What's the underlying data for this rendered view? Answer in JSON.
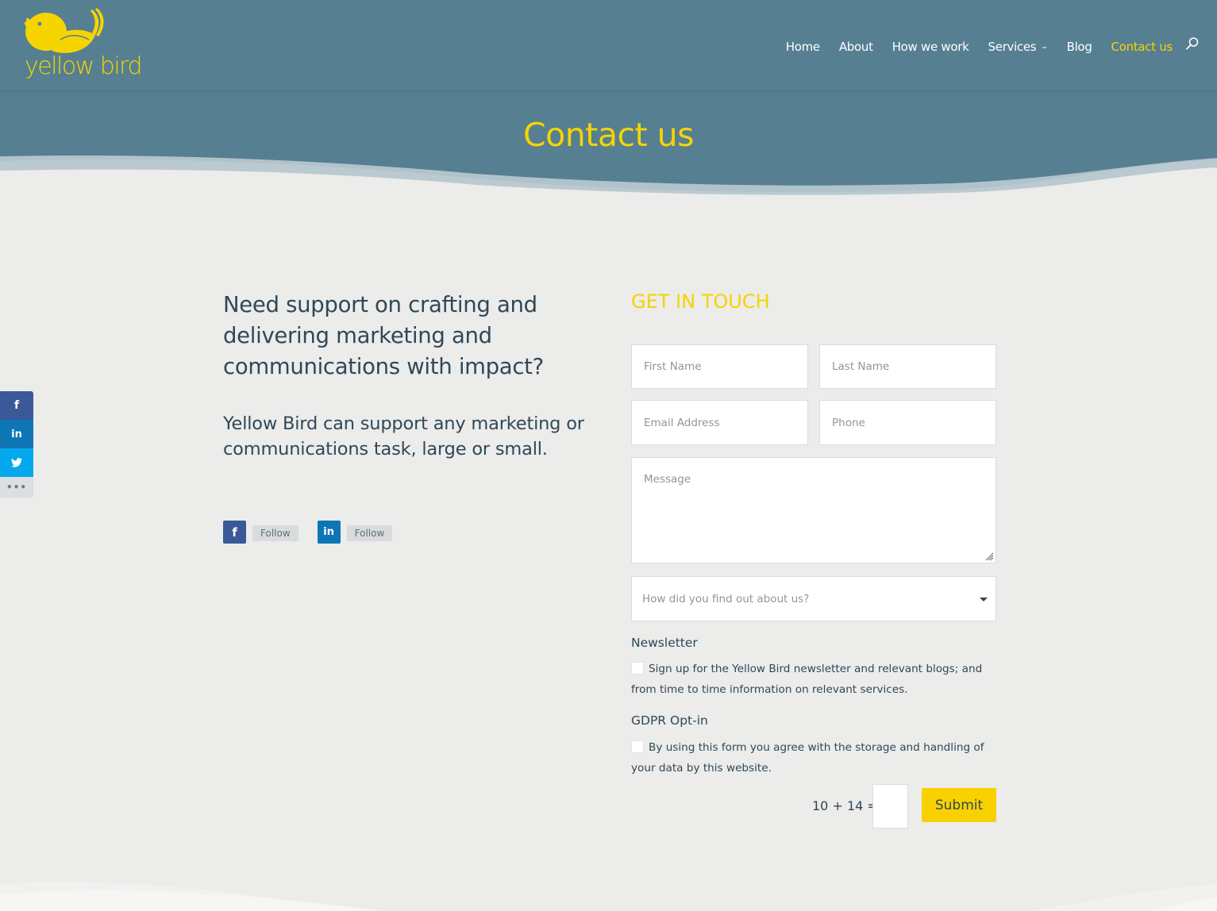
{
  "header": {
    "logo_text": "yellow bird",
    "nav": [
      {
        "label": "Home",
        "active": false,
        "has_dropdown": false
      },
      {
        "label": "About",
        "active": false,
        "has_dropdown": false
      },
      {
        "label": "How we work",
        "active": false,
        "has_dropdown": false
      },
      {
        "label": "Services",
        "active": false,
        "has_dropdown": true
      },
      {
        "label": "Blog",
        "active": false,
        "has_dropdown": false
      },
      {
        "label": "Contact us",
        "active": true,
        "has_dropdown": false
      }
    ],
    "search_icon": "search-icon",
    "dropdown_icon": "chevron-down-icon"
  },
  "hero": {
    "title": "Contact us"
  },
  "intro": {
    "lead": "Need support on crafting and delivering marketing and communications with impact?",
    "sub": "Yellow Bird can support any marketing or communications task, large or small."
  },
  "follow": [
    {
      "network": "facebook",
      "icon": "facebook-icon",
      "glyph": "f",
      "label": "Follow"
    },
    {
      "network": "linkedin",
      "icon": "linkedin-icon",
      "glyph": "in",
      "label": "Follow"
    }
  ],
  "share_bar": [
    {
      "network": "facebook",
      "icon": "facebook-icon",
      "glyph": "f"
    },
    {
      "network": "linkedin",
      "icon": "linkedin-icon",
      "glyph": "in"
    },
    {
      "network": "twitter",
      "icon": "twitter-icon",
      "glyph": "🐦"
    },
    {
      "network": "more",
      "icon": "more-icon",
      "glyph": "•••"
    }
  ],
  "form": {
    "title": "GET IN TOUCH",
    "first_name": {
      "placeholder": "First Name",
      "value": ""
    },
    "last_name": {
      "placeholder": "Last Name",
      "value": ""
    },
    "email": {
      "placeholder": "Email Address",
      "value": ""
    },
    "phone": {
      "placeholder": "Phone",
      "value": ""
    },
    "message": {
      "placeholder": "Message",
      "value": ""
    },
    "referral": {
      "selected": "How did you find out about us?"
    },
    "newsletter": {
      "heading": "Newsletter",
      "text": "Sign up for the Yellow Bird newsletter and relevant blogs; and from time to time information on relevant services.",
      "checked": false
    },
    "gdpr": {
      "heading": "GDPR Opt-in",
      "text": "By using this form you agree with the storage and handling of your data by this website.",
      "checked": false
    },
    "captcha": {
      "question": "10 + 14 =",
      "value": ""
    },
    "submit_label": "Submit"
  },
  "colors": {
    "brand_yellow": "#f5d400",
    "header_blue": "#567f92",
    "text_dark": "#2f4858",
    "background": "#ececea",
    "facebook": "#3b5998",
    "linkedin": "#0e76b5",
    "twitter": "#04a9ed"
  }
}
